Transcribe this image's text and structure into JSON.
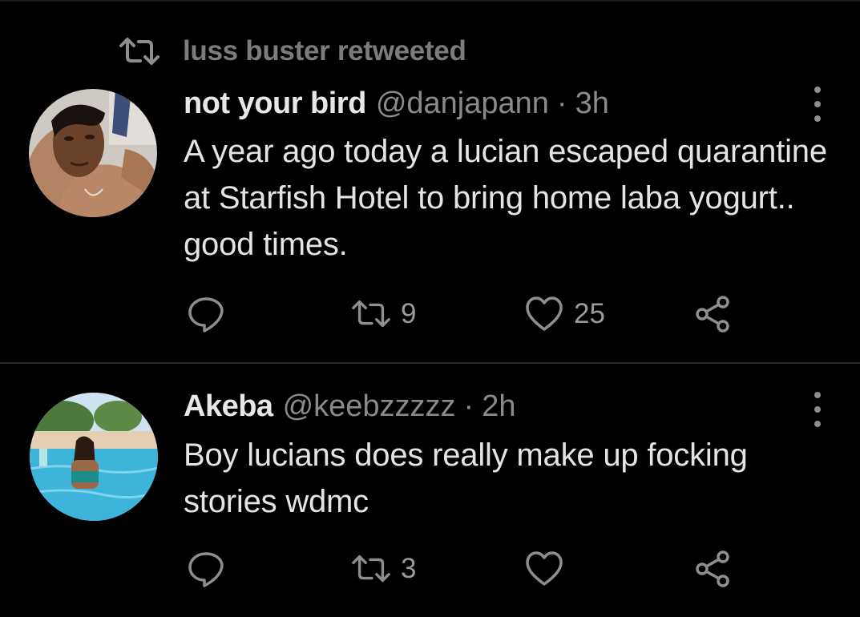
{
  "colors": {
    "background": "#000000",
    "divider": "#262626",
    "primary_text": "#e7e7e7",
    "secondary_text": "#8a8a8a",
    "icon": "#8e8e8e"
  },
  "social_context": {
    "icon": "retweet-icon",
    "label": "luss buster retweeted"
  },
  "tweets": [
    {
      "display_name": "not your bird",
      "handle": "@danjapann",
      "separator": "·",
      "time": "3h",
      "text": "A year ago today a lucian escaped quarantine at Starfish Hotel to bring home laba yogurt.. good times.",
      "actions": {
        "reply_icon": "comment-icon",
        "retweet_icon": "retweet-icon",
        "retweet_count": "9",
        "like_icon": "heart-icon",
        "like_count": "25",
        "share_icon": "share-icon"
      }
    },
    {
      "display_name": "Akeba",
      "handle": "@keebzzzzz",
      "separator": "·",
      "time": "2h",
      "text": "Boy lucians does really make up focking stories wdmc",
      "actions": {
        "reply_icon": "comment-icon",
        "retweet_icon": "retweet-icon",
        "retweet_count": "3",
        "like_icon": "heart-icon",
        "like_count": "",
        "share_icon": "share-icon"
      }
    }
  ]
}
